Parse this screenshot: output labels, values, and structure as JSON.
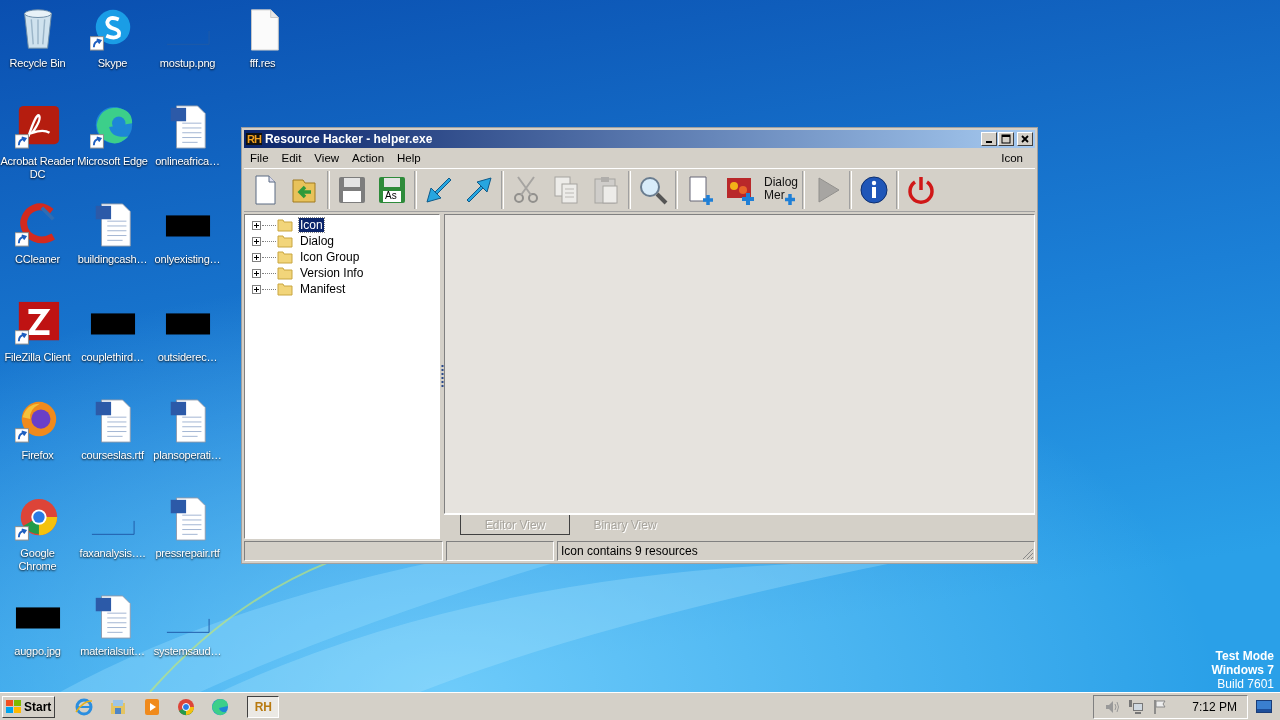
{
  "desktop": {
    "icons": [
      {
        "label": "Recycle Bin",
        "kind": "recycle-bin",
        "shortcut": false
      },
      {
        "label": "Acrobat Reader DC",
        "kind": "acrobat",
        "shortcut": true
      },
      {
        "label": "CCleaner",
        "kind": "ccleaner",
        "shortcut": true
      },
      {
        "label": "FileZilla Client",
        "kind": "filezilla",
        "shortcut": true
      },
      {
        "label": "Firefox",
        "kind": "firefox",
        "shortcut": true
      },
      {
        "label": "Google Chrome",
        "kind": "chrome",
        "shortcut": true
      },
      {
        "label": "augpo.jpg",
        "kind": "black-thumb",
        "shortcut": false
      },
      {
        "label": "Skype",
        "kind": "skype",
        "shortcut": true
      },
      {
        "label": "Microsoft Edge",
        "kind": "edge",
        "shortcut": true
      },
      {
        "label": "buildingcash…",
        "kind": "word-doc",
        "shortcut": false
      },
      {
        "label": "couplethird…",
        "kind": "black-thumb",
        "shortcut": false
      },
      {
        "label": "courseslas.rtf",
        "kind": "word-doc",
        "shortcut": false
      },
      {
        "label": "faxanalysis….",
        "kind": "blank-thumb",
        "shortcut": false
      },
      {
        "label": "materialsuit…",
        "kind": "word-doc",
        "shortcut": false
      },
      {
        "label": "mostup.png",
        "kind": "blank-thumb",
        "shortcut": false
      },
      {
        "label": "onlineafrica…",
        "kind": "word-doc",
        "shortcut": false
      },
      {
        "label": "onlyexisting…",
        "kind": "black-thumb",
        "shortcut": false
      },
      {
        "label": "outsiderec…",
        "kind": "black-thumb",
        "shortcut": false
      },
      {
        "label": "plansoperati…",
        "kind": "word-doc",
        "shortcut": false
      },
      {
        "label": "pressrepair.rtf",
        "kind": "word-doc",
        "shortcut": false
      },
      {
        "label": "systemsaud…",
        "kind": "blank-thumb",
        "shortcut": false
      },
      {
        "label": "fff.res",
        "kind": "file",
        "shortcut": false
      }
    ],
    "test_mode": [
      {
        "text": "Test Mode",
        "bold": true
      },
      {
        "text": "Windows 7",
        "bold": true
      },
      {
        "text": "Build 7601",
        "bold": false
      }
    ]
  },
  "window": {
    "logo": "RH",
    "title": "Resource Hacker - helper.exe",
    "menu": [
      "File",
      "Edit",
      "View",
      "Action",
      "Help"
    ],
    "menu_right": "Icon",
    "toolbar": [
      [
        {
          "kind": "new",
          "disabled": false
        },
        {
          "kind": "open",
          "disabled": false
        }
      ],
      [
        {
          "kind": "save",
          "disabled": false
        },
        {
          "kind": "save-as",
          "disabled": false,
          "label": "As"
        }
      ],
      [
        {
          "kind": "import",
          "disabled": false
        },
        {
          "kind": "export",
          "disabled": false
        }
      ],
      [
        {
          "kind": "cut",
          "disabled": true
        },
        {
          "kind": "copy",
          "disabled": true
        },
        {
          "kind": "paste",
          "disabled": true
        }
      ],
      [
        {
          "kind": "find",
          "disabled": false
        }
      ],
      [
        {
          "kind": "add-blank",
          "disabled": false
        },
        {
          "kind": "add-image",
          "disabled": false
        },
        {
          "kind": "dialog-merge",
          "disabled": false,
          "label": "Dialog",
          "label2": "Mer"
        }
      ],
      [
        {
          "kind": "run",
          "disabled": true
        }
      ],
      [
        {
          "kind": "info",
          "disabled": false
        }
      ],
      [
        {
          "kind": "exit",
          "disabled": false
        }
      ]
    ],
    "tree": [
      {
        "label": "Icon",
        "selected": true,
        "expanded": false
      },
      {
        "label": "Dialog",
        "selected": false,
        "expanded": false
      },
      {
        "label": "Icon Group",
        "selected": false,
        "expanded": false
      },
      {
        "label": "Version Info",
        "selected": false,
        "expanded": false
      },
      {
        "label": "Manifest",
        "selected": false,
        "expanded": false
      }
    ],
    "tabs": [
      {
        "label": "Editor View",
        "selected": true,
        "disabled": true
      },
      {
        "label": "Binary View",
        "selected": false,
        "disabled": true
      }
    ],
    "status": "Icon contains 9 resources"
  },
  "taskbar": {
    "start": "Start",
    "quick_launch": [
      {
        "kind": "ie"
      },
      {
        "kind": "explorer"
      },
      {
        "kind": "media"
      },
      {
        "kind": "chrome"
      },
      {
        "kind": "edge"
      }
    ],
    "tasks": [
      {
        "label": "RH",
        "selected": true
      }
    ],
    "tray": [
      {
        "kind": "speaker"
      },
      {
        "kind": "network"
      },
      {
        "kind": "flag"
      }
    ],
    "clock": "7:12 PM"
  }
}
